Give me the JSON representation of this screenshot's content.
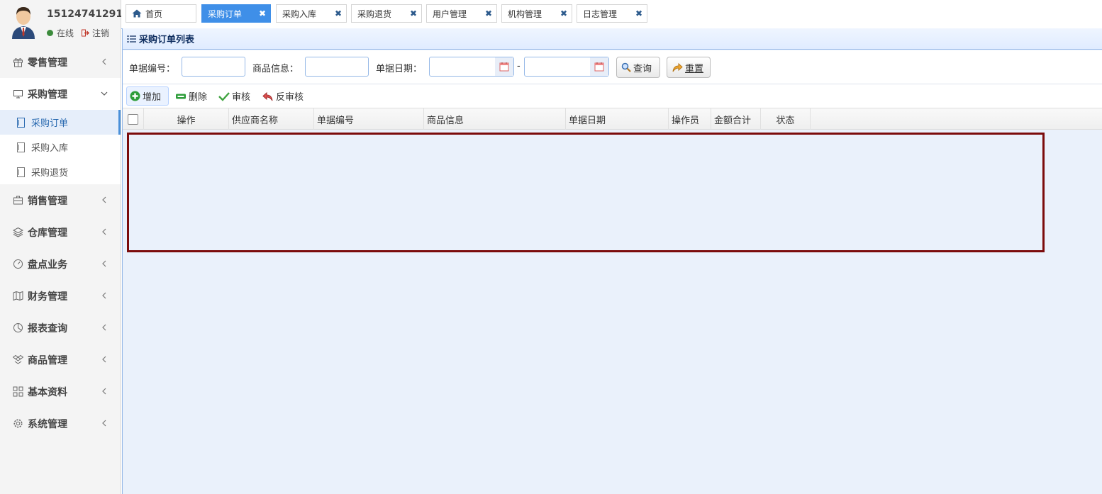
{
  "user": {
    "name": "15124741291",
    "status": "在线",
    "logout": "注销"
  },
  "menu": [
    {
      "label": "零售管理",
      "icon": "gift-icon"
    },
    {
      "label": "采购管理",
      "icon": "monitor-icon"
    },
    {
      "label": "销售管理",
      "icon": "briefcase-icon"
    },
    {
      "label": "仓库管理",
      "icon": "layers-icon"
    },
    {
      "label": "盘点业务",
      "icon": "gauge-icon"
    },
    {
      "label": "财务管理",
      "icon": "map-icon"
    },
    {
      "label": "报表查询",
      "icon": "pie-icon"
    },
    {
      "label": "商品管理",
      "icon": "dropbox-icon"
    },
    {
      "label": "基本资料",
      "icon": "grid-icon"
    },
    {
      "label": "系统管理",
      "icon": "gear-icon"
    }
  ],
  "submenu": [
    {
      "label": "采购订单"
    },
    {
      "label": "采购入库"
    },
    {
      "label": "采购退货"
    }
  ],
  "tabs": [
    {
      "label": "首页"
    },
    {
      "label": "采购订单"
    },
    {
      "label": "采购入库"
    },
    {
      "label": "采购退货"
    },
    {
      "label": "用户管理"
    },
    {
      "label": "机构管理"
    },
    {
      "label": "日志管理"
    }
  ],
  "panel": {
    "title": "采购订单列表"
  },
  "search": {
    "doc_no_label": "单据编号：",
    "doc_no_value": "",
    "goods_label": "商品信息：",
    "goods_value": "",
    "date_label": "单据日期：",
    "date_from": "",
    "date_sep": "-",
    "date_to": "",
    "query": "查询",
    "reset": "重置"
  },
  "toolbar": {
    "add": "增加",
    "delete": "删除",
    "audit": "审核",
    "unaudit": "反审核"
  },
  "columns": [
    "操作",
    "供应商名称",
    "单据编号",
    "商品信息",
    "单据日期",
    "操作员",
    "金额合计",
    "状态"
  ],
  "colors": {
    "accent": "#3f8fe8",
    "panel_border": "#95b8e7",
    "highlight": "#7b0b0b"
  }
}
